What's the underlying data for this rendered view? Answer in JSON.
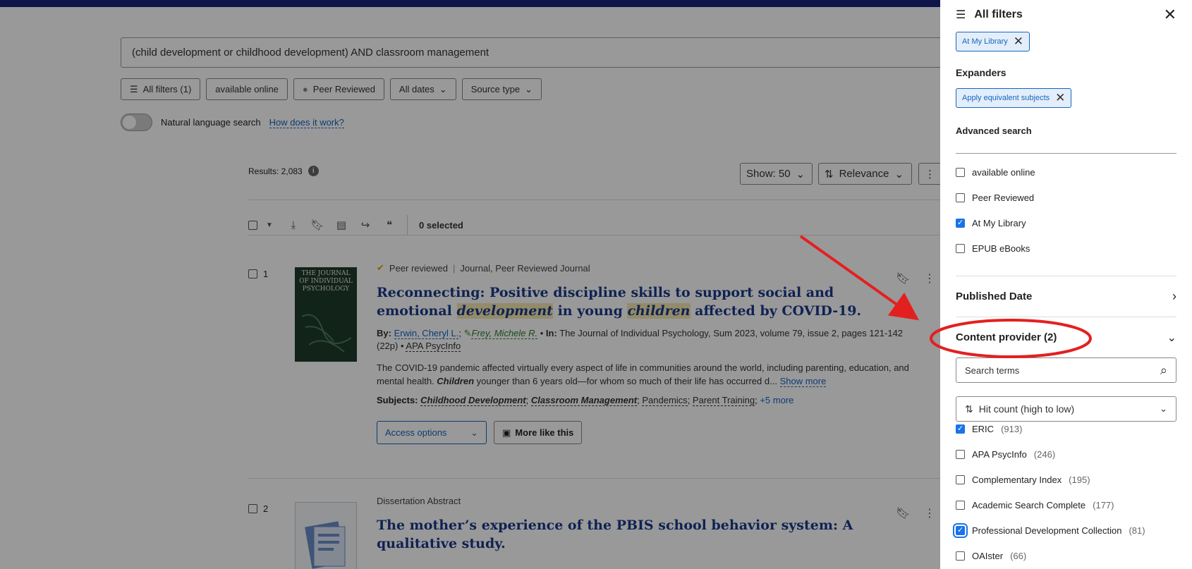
{
  "search": {
    "query": "(child development or childhood development) AND classroom management"
  },
  "filters": {
    "all_filters": "All filters (1)",
    "available_online": "available online",
    "peer_reviewed": "Peer Reviewed",
    "all_dates": "All dates",
    "source_type": "Source type"
  },
  "nls": {
    "label": "Natural language search",
    "help": "How does it work?"
  },
  "results": {
    "count": "Results: 2,083",
    "show": "Show: 50",
    "sort": "Relevance",
    "selected": "0 selected"
  },
  "items": [
    {
      "num": "1",
      "badge": "Peer reviewed",
      "type": "Journal, Peer Reviewed Journal",
      "title_a": "Reconnecting: Positive discipline skills to support social and emotional ",
      "title_hl1": "development",
      "title_b": " in young ",
      "title_hl2": "children",
      "title_c": " affected by COVID-19.",
      "by_label": "By:",
      "author1": "Erwin, Cheryl L.",
      "author2": "Frey, Michele R.",
      "in_label": "In:",
      "source": "The Journal of Individual Psychology, Sum 2023, volume 79, issue 2, pages 121-142 (22p)",
      "db": "APA PsycInfo",
      "abstract_a": "The COVID-19 pandemic affected virtually every aspect of life in communities around the world, including parenting, education, and mental health. ",
      "abstract_hl": "Children",
      "abstract_b": " younger than 6 years old—for whom so much of their life has occurred d...",
      "show_more": "Show more",
      "subjects_label": "Subjects:",
      "subj1": "Childhood Development",
      "subj2": "Classroom Management",
      "subj3": "Pandemics",
      "subj4": "Parent Training",
      "subj_more": "+5 more",
      "access": "Access options",
      "more_like": "More like this",
      "cover_text": "THE JOURNAL OF INDIVIDUAL PSYCHOLOGY"
    },
    {
      "num": "2",
      "type": "Dissertation Abstract",
      "title": "The mother’s experience of the PBIS school behavior system: A qualitative study."
    }
  ],
  "panel": {
    "title": "All filters",
    "tag_library": "At My Library",
    "expanders_label": "Expanders",
    "tag_expander": "Apply equivalent subjects",
    "advanced_label": "Advanced search",
    "adv": [
      {
        "label": "available online",
        "checked": false
      },
      {
        "label": "Peer Reviewed",
        "checked": false
      },
      {
        "label": "At My Library",
        "checked": true
      },
      {
        "label": "EPUB eBooks",
        "checked": false
      }
    ],
    "published_date": "Published Date",
    "content_provider": "Content provider (2)",
    "search_terms_placeholder": "Search terms",
    "sort": "Hit count (high to low)",
    "providers": [
      {
        "label": "ERIC",
        "count": "(913)",
        "checked": true
      },
      {
        "label": "APA PsycInfo",
        "count": "(246)",
        "checked": false
      },
      {
        "label": "Complementary Index",
        "count": "(195)",
        "checked": false
      },
      {
        "label": "Academic Search Complete",
        "count": "(177)",
        "checked": false
      },
      {
        "label": "Professional Development Collection",
        "count": "(81)",
        "checked": true
      },
      {
        "label": "OAIster",
        "count": "(66)",
        "checked": false
      }
    ]
  },
  "colors": {
    "accent": "#1565c0",
    "annotation": "#e32020",
    "overlay": "rgba(0,0,0,0.40)"
  }
}
